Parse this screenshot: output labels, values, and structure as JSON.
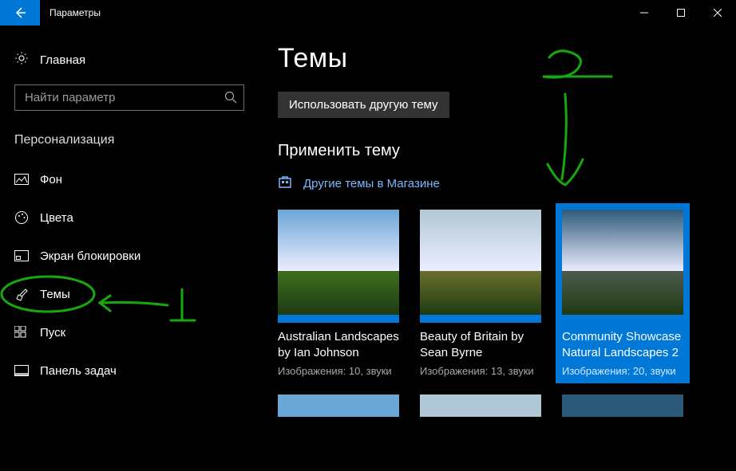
{
  "window": {
    "title": "Параметры"
  },
  "sidebar": {
    "home_label": "Главная",
    "search_placeholder": "Найти параметр",
    "category_label": "Персонализация",
    "items": [
      {
        "label": "Фон",
        "icon": "picture"
      },
      {
        "label": "Цвета",
        "icon": "palette"
      },
      {
        "label": "Экран блокировки",
        "icon": "lock"
      },
      {
        "label": "Темы",
        "icon": "brush",
        "active": true
      },
      {
        "label": "Пуск",
        "icon": "grid"
      },
      {
        "label": "Панель задач",
        "icon": "taskbar"
      }
    ]
  },
  "main": {
    "heading": "Темы",
    "use_other_label": "Использовать другую тему",
    "apply_label": "Применить тему",
    "store_link_label": "Другие темы в Магазине",
    "themes": [
      {
        "title": "Australian Landscapes by Ian Johnson",
        "meta": "Изображения: 10, звуки",
        "accent": "#0078d7",
        "sky": "#6aa6d6",
        "ground": "#3c6f1f",
        "selected": false
      },
      {
        "title": "Beauty of Britain by Sean Byrne",
        "meta": "Изображения: 13, звуки",
        "accent": "#0078d7",
        "sky": "#b0c8d6",
        "ground": "#6b6f2e",
        "selected": false
      },
      {
        "title": "Community Showcase Natural Landscapes 2",
        "meta": "Изображения: 20, звуки",
        "accent": "#0078d7",
        "sky": "#2e5a7a",
        "ground": "#4c5b4e",
        "selected": true
      }
    ],
    "themes_row2": [
      {
        "sky": "#6aa6d6"
      },
      {
        "sky": "#b0c8d6"
      },
      {
        "sky": "#2e5a7a"
      }
    ]
  },
  "colors": {
    "accent": "#0078d7",
    "annotation": "#17a80f"
  }
}
